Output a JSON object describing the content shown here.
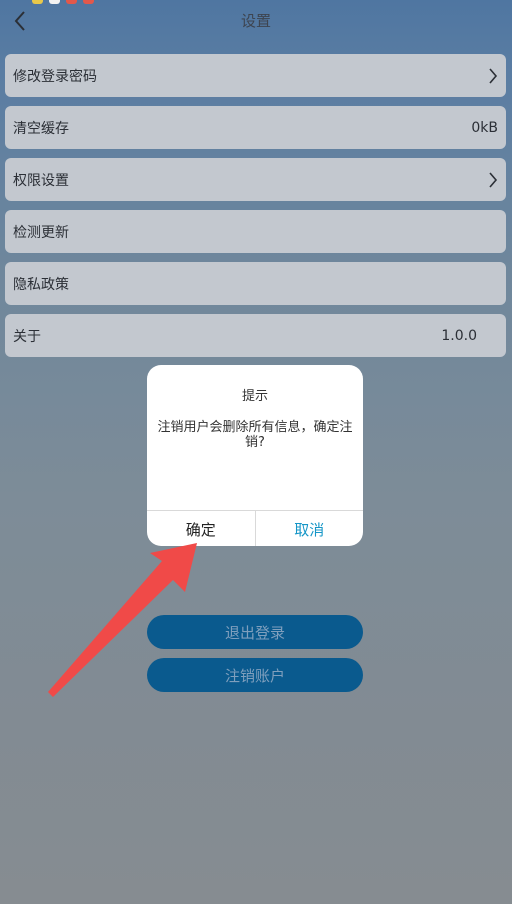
{
  "colors": {
    "status_dot_1": "#e8c84a",
    "status_dot_2": "#f2f2f2",
    "status_dot_3": "#e2584b",
    "status_dot_4": "#e2584b",
    "row_background": "#c3c8cf",
    "button_background": "#0a5a8e",
    "button_text": "#7f9fbd",
    "cancel_text": "#1596c7",
    "annotation_arrow": "#f04a48"
  },
  "header": {
    "title": "设置",
    "back_icon": "chevron-left-icon"
  },
  "settings": {
    "items": [
      {
        "label": "修改登录密码",
        "value": "",
        "icon": "chevron-right-icon"
      },
      {
        "label": "清空缓存",
        "value": "0kB",
        "icon": ""
      },
      {
        "label": "权限设置",
        "value": "",
        "icon": "chevron-right-icon"
      },
      {
        "label": "检测更新",
        "value": "",
        "icon": ""
      },
      {
        "label": "隐私政策",
        "value": "",
        "icon": ""
      },
      {
        "label": "关于",
        "value": "1.0.0",
        "icon": ""
      }
    ]
  },
  "actions": {
    "logout_label": "退出登录",
    "deregister_label": "注销账户"
  },
  "dialog": {
    "title": "提示",
    "message": "注销用户会删除所有信息，确定注销?",
    "confirm_label": "确定",
    "cancel_label": "取消"
  }
}
